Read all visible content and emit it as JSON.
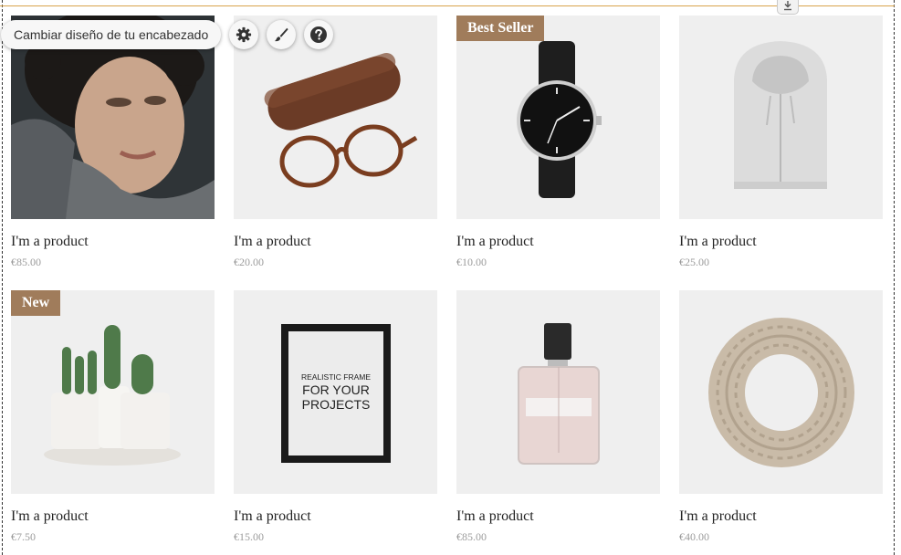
{
  "editor": {
    "change_header_label": "Cambiar diseño de tu encabezado",
    "settings_icon": "gear-icon",
    "design_icon": "paintbrush-icon",
    "help_icon": "help-icon",
    "anchor_icon": "download-arrow-icon",
    "guide_color": "#d8a34c"
  },
  "colors": {
    "ribbon_bg": "#a07c5b",
    "thumb_bg": "#efefef",
    "price": "#9b9b9b"
  },
  "products": [
    {
      "name": "I'm a product",
      "price": "€85.00",
      "ribbon": "",
      "image": "woman-portrait"
    },
    {
      "name": "I'm a product",
      "price": "€20.00",
      "ribbon": "",
      "image": "glasses-case"
    },
    {
      "name": "I'm a product",
      "price": "€10.00",
      "ribbon": "Best Seller",
      "image": "wristwatch"
    },
    {
      "name": "I'm a product",
      "price": "€25.00",
      "ribbon": "",
      "image": "hoodie"
    },
    {
      "name": "I'm a product",
      "price": "€7.50",
      "ribbon": "New",
      "image": "cactus-pots"
    },
    {
      "name": "I'm a product",
      "price": "€15.00",
      "ribbon": "",
      "image": "picture-frame"
    },
    {
      "name": "I'm a product",
      "price": "€85.00",
      "ribbon": "",
      "image": "perfume-bottle"
    },
    {
      "name": "I'm a product",
      "price": "€40.00",
      "ribbon": "",
      "image": "knit-scarf"
    }
  ],
  "frame_poster": {
    "line1": "REALISTIC FRAME",
    "line2": "FOR YOUR",
    "line3": "PROJECTS"
  }
}
